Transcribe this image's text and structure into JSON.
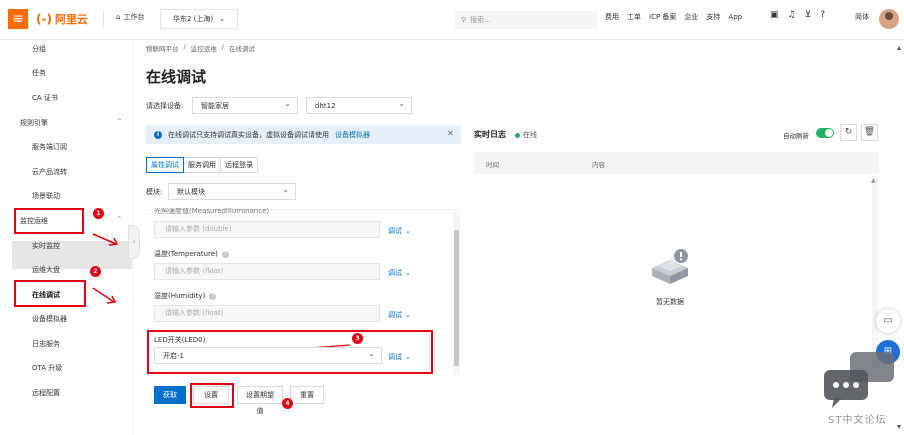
{
  "topbar": {
    "logo_text": "阿里云",
    "workbench": "工作台",
    "region": "华东2 (上海)",
    "search_placeholder": "搜索...",
    "nav": [
      "费用",
      "工单",
      "ICP 备案",
      "企业",
      "支持",
      "App"
    ],
    "lang": "简体"
  },
  "sidebar": {
    "items_top": [
      "分组",
      "任务",
      "CA 证书"
    ],
    "group_rules": "规则引擎",
    "rules_items": [
      "服务端订阅",
      "云产品流转",
      "场景联动"
    ],
    "group_ops": "监控运维",
    "ops_items": [
      "实时监控",
      "运维大盘",
      "在线调试",
      "设备模拟器",
      "日志服务",
      "OTA 升级",
      "远程配置"
    ],
    "active": "在线调试"
  },
  "main": {
    "breadcrumb": [
      "物联网平台",
      "/",
      "监控运维",
      "/",
      "在线调试"
    ],
    "title": "在线调试",
    "device_label": "请选择设备:",
    "product_select": "智能家居",
    "device_select": "dht12",
    "notice_text": "在线调试只支持调试真实设备，虚拟设备调试请使用",
    "notice_link": "设备模拟器",
    "tabs": [
      "属性调试",
      "服务调用",
      "远程登录"
    ],
    "active_tab": "属性调试",
    "module_label": "模块:",
    "module_select": "默认模块",
    "properties": [
      {
        "label": "光照强度值(MeasuredIlluminance)",
        "placeholder": "请输入参数 (double)",
        "debug": "调试"
      },
      {
        "label": "温度(Temperature)",
        "placeholder": "请输入参数 (float)",
        "debug": "调试"
      },
      {
        "label": "湿度(Humidity)",
        "placeholder": "请输入参数 (float)",
        "debug": "调试"
      }
    ],
    "led": {
      "label": "LED开关(LED0)",
      "value": "开启-1",
      "debug": "调试"
    },
    "buttons": {
      "get": "获取",
      "set": "设置",
      "set_expected": "设置期望值",
      "reset": "重置"
    }
  },
  "log": {
    "title": "实时日志",
    "status": "在线",
    "auto_refresh": "自动刷新",
    "col_time": "时间",
    "col_content": "内容",
    "empty": "暂无数据"
  },
  "annotations": [
    "1",
    "2",
    "3",
    "4"
  ],
  "watermark": "ST中文论坛",
  "colors": {
    "brand": "#ff6a00",
    "primary": "#0070cc",
    "online": "#23b066",
    "annotation": "#e60012"
  }
}
